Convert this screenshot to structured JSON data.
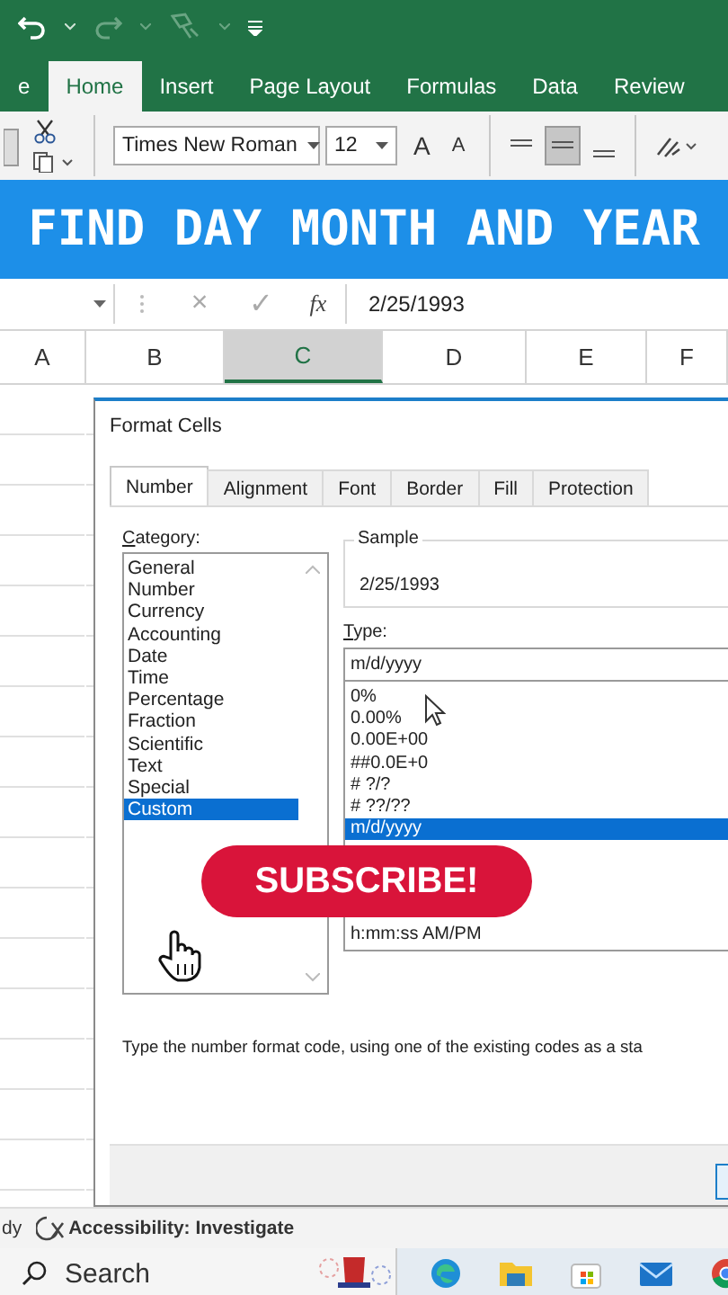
{
  "ribbon_tabs": [
    {
      "label": "e",
      "selected": false
    },
    {
      "label": "Home",
      "selected": true
    },
    {
      "label": "Insert",
      "selected": false
    },
    {
      "label": "Page Layout",
      "selected": false
    },
    {
      "label": "Formulas",
      "selected": false
    },
    {
      "label": "Data",
      "selected": false
    },
    {
      "label": "Review",
      "selected": false
    }
  ],
  "font": {
    "name": "Times New Roman",
    "size": "12",
    "grow": "A",
    "shrink": "A"
  },
  "banner": {
    "title": "FIND DAY MONTH AND YEAR"
  },
  "formula_bar": {
    "cancel": "×",
    "enter": "✓",
    "function": "fx",
    "value": "2/25/1993"
  },
  "columns": [
    {
      "label": "A",
      "selected": false
    },
    {
      "label": "B",
      "selected": false
    },
    {
      "label": "C",
      "selected": true
    },
    {
      "label": "D",
      "selected": false
    },
    {
      "label": "E",
      "selected": false
    },
    {
      "label": "F",
      "selected": false
    }
  ],
  "dialog": {
    "title": "Format Cells",
    "tabs": [
      {
        "label": "Number",
        "selected": true
      },
      {
        "label": "Alignment",
        "selected": false
      },
      {
        "label": "Font",
        "selected": false
      },
      {
        "label": "Border",
        "selected": false
      },
      {
        "label": "Fill",
        "selected": false
      },
      {
        "label": "Protection",
        "selected": false
      }
    ],
    "category_label": "Category:",
    "categories": [
      {
        "label": "General",
        "selected": false
      },
      {
        "label": "Number",
        "selected": false
      },
      {
        "label": "Currency",
        "selected": false
      },
      {
        "label": "Accounting",
        "selected": false
      },
      {
        "label": "Date",
        "selected": false
      },
      {
        "label": "Time",
        "selected": false
      },
      {
        "label": "Percentage",
        "selected": false
      },
      {
        "label": "Fraction",
        "selected": false
      },
      {
        "label": "Scientific",
        "selected": false
      },
      {
        "label": "Text",
        "selected": false
      },
      {
        "label": "Special",
        "selected": false
      },
      {
        "label": "Custom",
        "selected": true
      }
    ],
    "sample_label": "Sample",
    "sample": "2/25/1993",
    "type_label": "Type:",
    "type_value": "m/d/yyyy",
    "types": [
      {
        "label": "0%",
        "selected": false
      },
      {
        "label": "0.00%",
        "selected": false
      },
      {
        "label": "0.00E+00",
        "selected": false
      },
      {
        "label": "##0.0E+0",
        "selected": false
      },
      {
        "label": "# ?/?",
        "selected": false
      },
      {
        "label": "# ??/??",
        "selected": false
      },
      {
        "label": "m/d/yyyy",
        "selected": true
      },
      {
        "label": "h:mm:ss AM/PM",
        "selected": false
      }
    ],
    "hint": "Type the number format code, using one of the existing codes as a sta"
  },
  "overlay": {
    "subscribe": "SUBSCRIBE!"
  },
  "status_bar": {
    "mode": "dy",
    "accessibility": "Accessibility: Investigate"
  },
  "taskbar": {
    "search_placeholder": "Search"
  }
}
